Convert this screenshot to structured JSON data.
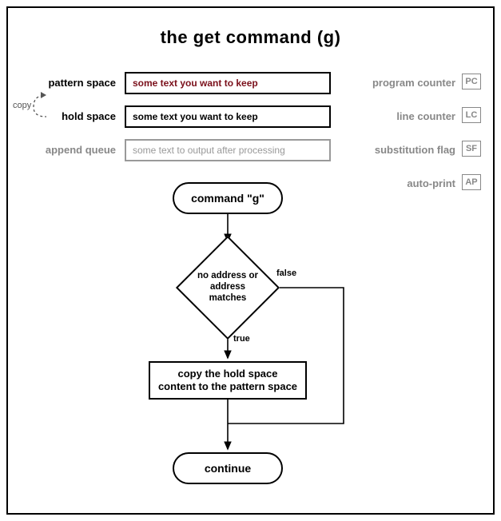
{
  "title": "the get command (g)",
  "copy_label": "copy",
  "spaces": {
    "pattern": {
      "label": "pattern space",
      "value": "some text you want to keep"
    },
    "hold": {
      "label": "hold space",
      "value": "some text you want to keep"
    },
    "append": {
      "label": "append queue",
      "value": "some text to output after processing"
    }
  },
  "registers": {
    "pc": {
      "label": "program counter",
      "code": "PC"
    },
    "lc": {
      "label": "line counter",
      "code": "LC"
    },
    "sf": {
      "label": "substitution flag",
      "code": "SF"
    },
    "ap": {
      "label": "auto-print",
      "code": "AP"
    }
  },
  "flow": {
    "start": "command \"g\"",
    "decision": "no address\nor address\nmatches",
    "true_label": "true",
    "false_label": "false",
    "action": "copy the hold space\ncontent to the pattern space",
    "end": "continue"
  }
}
